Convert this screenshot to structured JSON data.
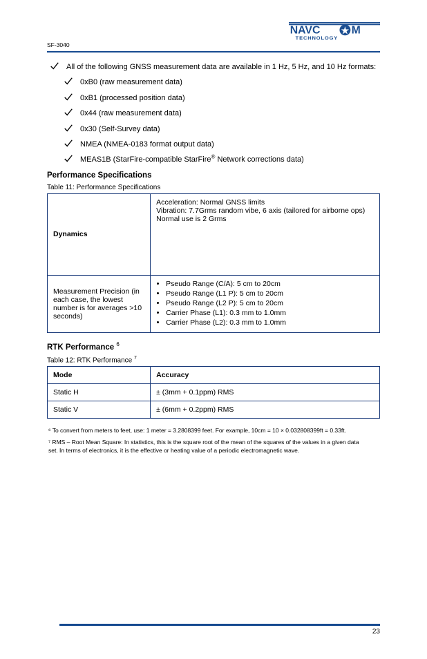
{
  "header": {
    "model": "SF-3040"
  },
  "logo": {
    "name": "NAVCOM TECHNOLOGY"
  },
  "intro_bullet": "All of the following GNSS measurement data are available in 1 Hz, 5 Hz, and 10 Hz formats:",
  "sub_bullets": [
    "0xB0 (raw measurement data)",
    "0xB1 (processed position data)",
    "0x44 (raw measurement data)",
    "0x30 (Self-Survey data)",
    "NMEA (NMEA-0183 format output data)",
    "MEAS1B (StarFire-compatible StarFire",
    "Network corrections data)"
  ],
  "reg_marker": "®",
  "section_performance": "Performance Specifications",
  "table1_caption": "Table 11: Performance Specifications",
  "table1": {
    "rows": [
      {
        "label": "Dynamics",
        "value": "Acceleration: Normal GNSS limits\nVibration: 7.7Grms random vibe, 6 axis (tailored for airborne ops)\nNormal use is 2 Grms"
      },
      {
        "label": "Measurement Precision (in each case, the lowest number is for averages >10 seconds)",
        "items": [
          "Pseudo Range (C/A): 5 cm to 20cm",
          "Pseudo Range (L1 P): 5 cm to 20cm",
          "Pseudo Range (L2 P): 5 cm to 20cm",
          "Carrier Phase (L1): 0.3 mm to 1.0mm",
          "Carrier Phase (L2): 0.3 mm to 1.0mm"
        ]
      }
    ]
  },
  "section_rtk": "RTK Performance",
  "table2_caption": "Table 12: RTK Performance",
  "table2": {
    "header": [
      "Mode",
      "Accuracy"
    ],
    "rows": [
      [
        "Static H",
        "± (3mm + 0.1ppm) RMS"
      ],
      [
        "Static V",
        "± (6mm + 0.2ppm) RMS"
      ]
    ]
  },
  "footnotes": [
    "⁶ To convert from meters to feet, use: 1 meter = 3.2808399 feet. For example, 10cm = 10 × 0.032808399ft = 0.33ft.",
    "⁷ RMS – Root Mean Square: In statistics, this is the square root of the mean of the squares of the values in a given data set. In terms of electronics, it is the effective or heating value of a periodic electromagnetic wave."
  ],
  "page_number": "23"
}
